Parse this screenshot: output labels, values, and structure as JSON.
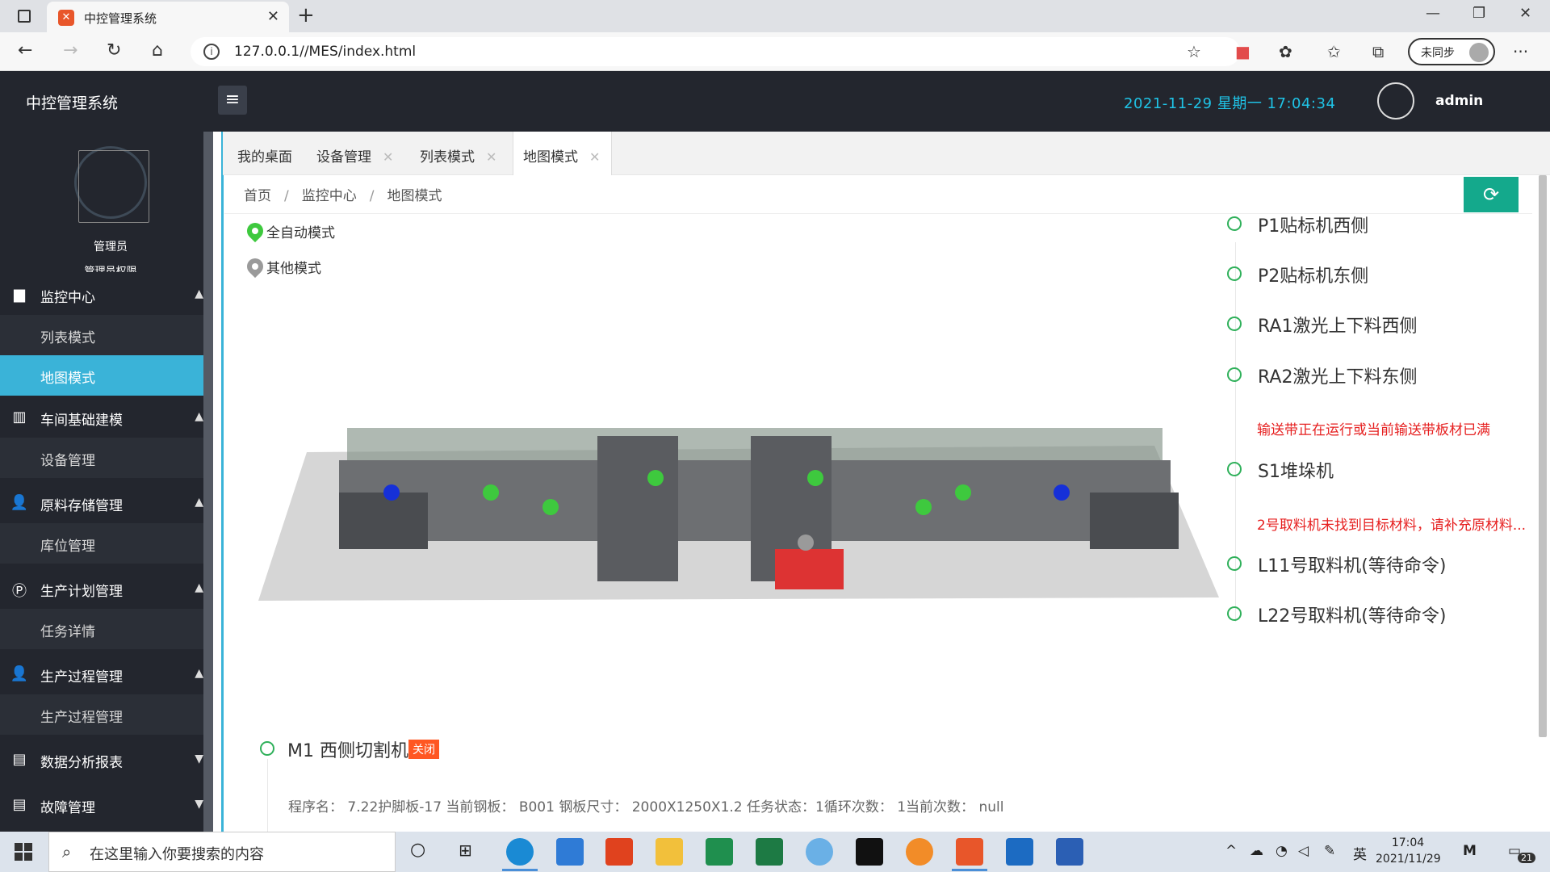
{
  "browser": {
    "tab_title": "中控管理系统",
    "tab_favicon": "app-logo",
    "url": "127.0.0.1//MES/index.html",
    "sync_label": "未同步"
  },
  "header": {
    "brand": "中控管理系统",
    "datetime": "2021-11-29  星期一  17:04:34",
    "user": "admin",
    "accent": "#1fc3e6"
  },
  "sidebar": {
    "role": "管理员",
    "role_sub": "管理员权限",
    "groups": [
      {
        "label": "监控中心",
        "icon": "building-icon",
        "expanded": true,
        "items": [
          "列表模式",
          "地图模式"
        ]
      },
      {
        "label": "车间基础建模",
        "icon": "factory-icon",
        "expanded": true,
        "items": [
          "设备管理"
        ]
      },
      {
        "label": "原料存储管理",
        "icon": "person-icon",
        "expanded": true,
        "items": [
          "库位管理"
        ]
      },
      {
        "label": "生产计划管理",
        "icon": "p-circle-icon",
        "expanded": true,
        "items": [
          "任务详情"
        ]
      },
      {
        "label": "生产过程管理",
        "icon": "user-icon",
        "expanded": true,
        "items": [
          "生产过程管理"
        ]
      },
      {
        "label": "数据分析报表",
        "icon": "report-icon",
        "expanded": false,
        "items": []
      },
      {
        "label": "故障管理",
        "icon": "fault-icon",
        "expanded": false,
        "items": []
      }
    ],
    "active_item": "地图模式",
    "active_color": "#3ab3d8"
  },
  "tabs": [
    {
      "label": "我的桌面",
      "closable": false
    },
    {
      "label": "设备管理",
      "closable": true
    },
    {
      "label": "列表模式",
      "closable": true
    },
    {
      "label": "地图模式",
      "closable": true,
      "active": true
    }
  ],
  "breadcrumb": [
    "首页",
    "监控中心",
    "地图模式"
  ],
  "legend": [
    {
      "label": "全自动模式",
      "color": "#3ec93e"
    },
    {
      "label": "其他模式",
      "color": "#9a9a9a"
    }
  ],
  "status_list": [
    {
      "label": "P1贴标机西侧"
    },
    {
      "label": "P2贴标机东侧"
    },
    {
      "label": "RA1激光上下料西侧"
    },
    {
      "label": "RA2激光上下料东侧",
      "warning": "输送带正在运行或当前输送带板材已满"
    },
    {
      "label": "S1堆垛机",
      "warning": "2号取料机未找到目标材料，请补充原材料..."
    },
    {
      "label": "L11号取料机(等待命令)"
    },
    {
      "label": "L22号取料机(等待命令)"
    }
  ],
  "machine": {
    "name": "M1 西侧切割机",
    "badge": "关闭",
    "badge_color": "#ff5722",
    "info": "程序名：  7.22护脚板-17 当前钢板：  B001 钢板尺寸：  2000X1250X1.2 任务状态：1循环次数：  1当前次数：  null"
  },
  "taskbar": {
    "search_placeholder": "在这里输入你要搜索的内容",
    "ime": "英",
    "time": "17:04",
    "date": "2021/11/29",
    "notifications": "21"
  }
}
